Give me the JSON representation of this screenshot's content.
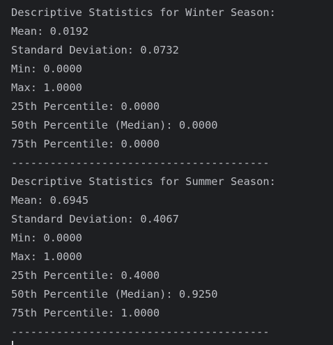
{
  "console": {
    "lines": [
      "Descriptive Statistics for Winter Season:",
      "Mean: 0.0192",
      "Standard Deviation: 0.0732",
      "Min: 0.0000",
      "Max: 1.0000",
      "25th Percentile: 0.0000",
      "50th Percentile (Median): 0.0000",
      "75th Percentile: 0.0000",
      "----------------------------------------",
      "Descriptive Statistics for Summer Season:",
      "Mean: 0.6945",
      "Standard Deviation: 0.4067",
      "Min: 0.0000",
      "Max: 1.0000",
      "25th Percentile: 0.4000",
      "50th Percentile (Median): 0.9250",
      "75th Percentile: 1.0000",
      "----------------------------------------"
    ]
  },
  "colors": {
    "background": "#1e1f22",
    "text": "#bcbec4"
  }
}
